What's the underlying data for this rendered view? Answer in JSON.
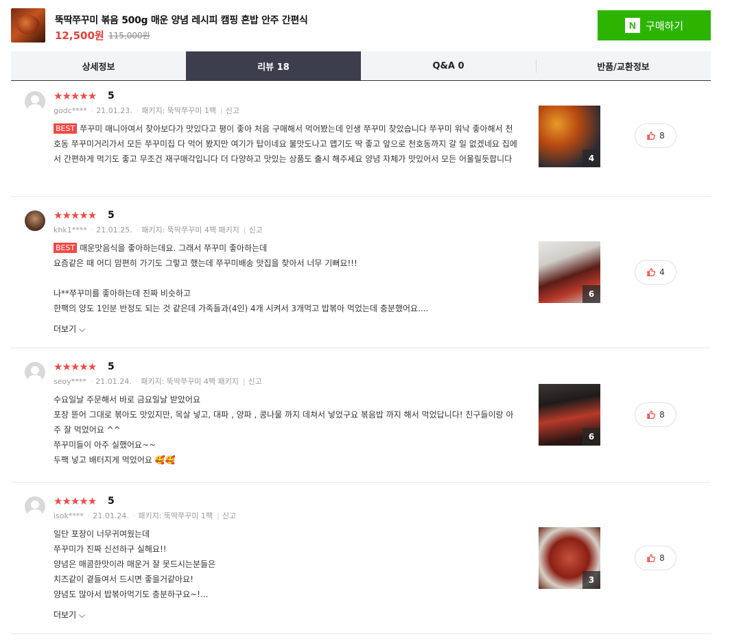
{
  "product": {
    "name": "뚝딱쭈꾸미 볶음 500g 매운 양념 레시피 캠핑 혼밥 안주 간편식",
    "price": "12,500원",
    "original_price": "115,000원",
    "buy_label": "구매하기",
    "buy_logo": "N"
  },
  "tabs": [
    {
      "label": "상세정보"
    },
    {
      "label": "리뷰 18"
    },
    {
      "label": "Q&A 0"
    },
    {
      "label": "반품/교환정보"
    }
  ],
  "reviews": [
    {
      "stars": "★★★★★",
      "score": "5",
      "user": "godc****",
      "date": "21.01.23.",
      "package": "패키지: 뚝딱쭈꾸미 1팩",
      "report": "신고",
      "best_label": "BEST",
      "text": "쭈꾸미 매니아여서 찾아보다가 맛있다고 평이 좋아 처음 구매해서 먹어봤는데 인생 쭈꾸미 찾았습니다 쭈꾸미 워낙 좋아해서 천호동 쭈꾸미거리가서 모든 쭈꾸미집 다 먹어 봤지만 여기가 탑이네요 불맛도나고 맵기도 딱 좋고 앞으로 천호동까지 갈 일 없겠네요 집에서 간편하게 먹기도 좋고 무조건 재구매각입니다 더 다양하고 맛있는 상품도 출시 해주세요 양념 자체가 맛있어서 모든 어울릴듯합니다",
      "image_count": "4",
      "likes": "8"
    },
    {
      "stars": "★★★★★",
      "score": "5",
      "user": "khk1****",
      "date": "21.01.25.",
      "package": "패키지: 뚝딱쭈꾸미 4팩 패키지",
      "report": "신고",
      "best_label": "BEST",
      "text": "매운맛음식을 좋아하는데요. 그래서 쭈꾸미 좋아하는데\n요즘같은 때 어디 맘편히 가기도 그렇고 했는데 쭈꾸미배송 맛집을 찾아서 너무 기뻐요!!!\n\n나**쭈꾸미를 좋아하는데 진짜 비슷하고\n한팩의 양도 1인분 반정도 되는 것 같은데 가족들과(4인) 4개 시켜서 3개먹고 밥볶아 먹었는데 충분했어요....",
      "more": "더보기",
      "image_count": "6",
      "likes": "4"
    },
    {
      "stars": "★★★★★",
      "score": "5",
      "user": "seoy****",
      "date": "21.01.24.",
      "package": "패키지: 뚝딱쭈꾸미 4팩 패키지",
      "report": "신고",
      "text": "수요일날 주문해서 바로 금요일날 받았어요\n포장 뜯어 그대로 볶아도 맛있지만, 목살 넣고, 대파 , 양파 , 콩나물 까지 데쳐서 넣었구요 볶음밥 까지 해서 먹었답니다! 친구들이랑 아주 잘 먹었어요 ^^\n쭈꾸미들이 아주 실했어요~~\n두팩 넣고 배터지게 먹었어요 🥰🥰",
      "image_count": "6",
      "likes": "8"
    },
    {
      "stars": "★★★★★",
      "score": "5",
      "user": "isok****",
      "date": "21.01.24.",
      "package": "패키지: 뚝딱쭈꾸미 1팩",
      "report": "신고",
      "text": "일단 포장이 너무귀여웠는데\n쭈꾸미가 진짜 신선하구 실해요!!\n양념은 매콤한맛이라 매운거 잘 못드시는분들은\n치즈같이 곁들여서 드시면 좋을거같아요!\n양념도 많아서 밥볶아먹기도 충분하구요~!...",
      "more": "더보기",
      "image_count": "3",
      "likes": "8"
    }
  ]
}
